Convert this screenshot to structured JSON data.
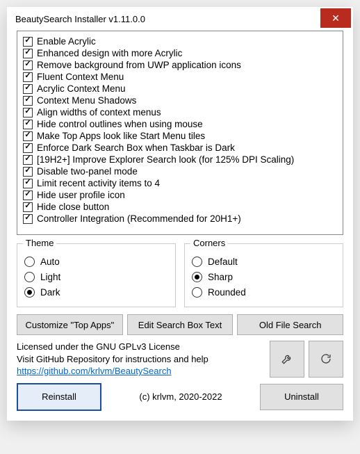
{
  "window": {
    "title": "BeautySearch Installer v1.11.0.0"
  },
  "checklist": [
    {
      "label": "Enable Acrylic",
      "checked": true
    },
    {
      "label": "Enhanced design with more Acrylic",
      "checked": true
    },
    {
      "label": "Remove background from UWP application icons",
      "checked": true
    },
    {
      "label": "Fluent Context Menu",
      "checked": true
    },
    {
      "label": "Acrylic Context Menu",
      "checked": true
    },
    {
      "label": "Context Menu Shadows",
      "checked": true
    },
    {
      "label": "Align widths of context menus",
      "checked": true
    },
    {
      "label": "Hide control outlines when using mouse",
      "checked": true
    },
    {
      "label": "Make Top Apps look like Start Menu tiles",
      "checked": true
    },
    {
      "label": "Enforce Dark Search Box when Taskbar is Dark",
      "checked": true
    },
    {
      "label": "[19H2+] Improve Explorer Search look (for 125% DPI Scaling)",
      "checked": true
    },
    {
      "label": "Disable two-panel mode",
      "checked": true
    },
    {
      "label": "Limit recent activity items to 4",
      "checked": true
    },
    {
      "label": "Hide user profile icon",
      "checked": true
    },
    {
      "label": "Hide close button",
      "checked": true
    },
    {
      "label": "Controller Integration (Recommended for 20H1+)",
      "checked": true
    }
  ],
  "theme": {
    "legend": "Theme",
    "options": [
      {
        "label": "Auto",
        "selected": false
      },
      {
        "label": "Light",
        "selected": false
      },
      {
        "label": "Dark",
        "selected": true
      }
    ]
  },
  "corners": {
    "legend": "Corners",
    "options": [
      {
        "label": "Default",
        "selected": false
      },
      {
        "label": "Sharp",
        "selected": true
      },
      {
        "label": "Rounded",
        "selected": false
      }
    ]
  },
  "buttons": {
    "customize": "Customize \"Top Apps\"",
    "editSearch": "Edit Search Box Text",
    "oldFileSearch": "Old File Search",
    "reinstall": "Reinstall",
    "uninstall": "Uninstall"
  },
  "info": {
    "line1": "Licensed under the GNU GPLv3 License",
    "line2": "Visit GitHub Repository for instructions and help",
    "link": "https://github.com/krlvm/BeautySearch"
  },
  "copyright": "(c) krlvm, 2020-2022"
}
